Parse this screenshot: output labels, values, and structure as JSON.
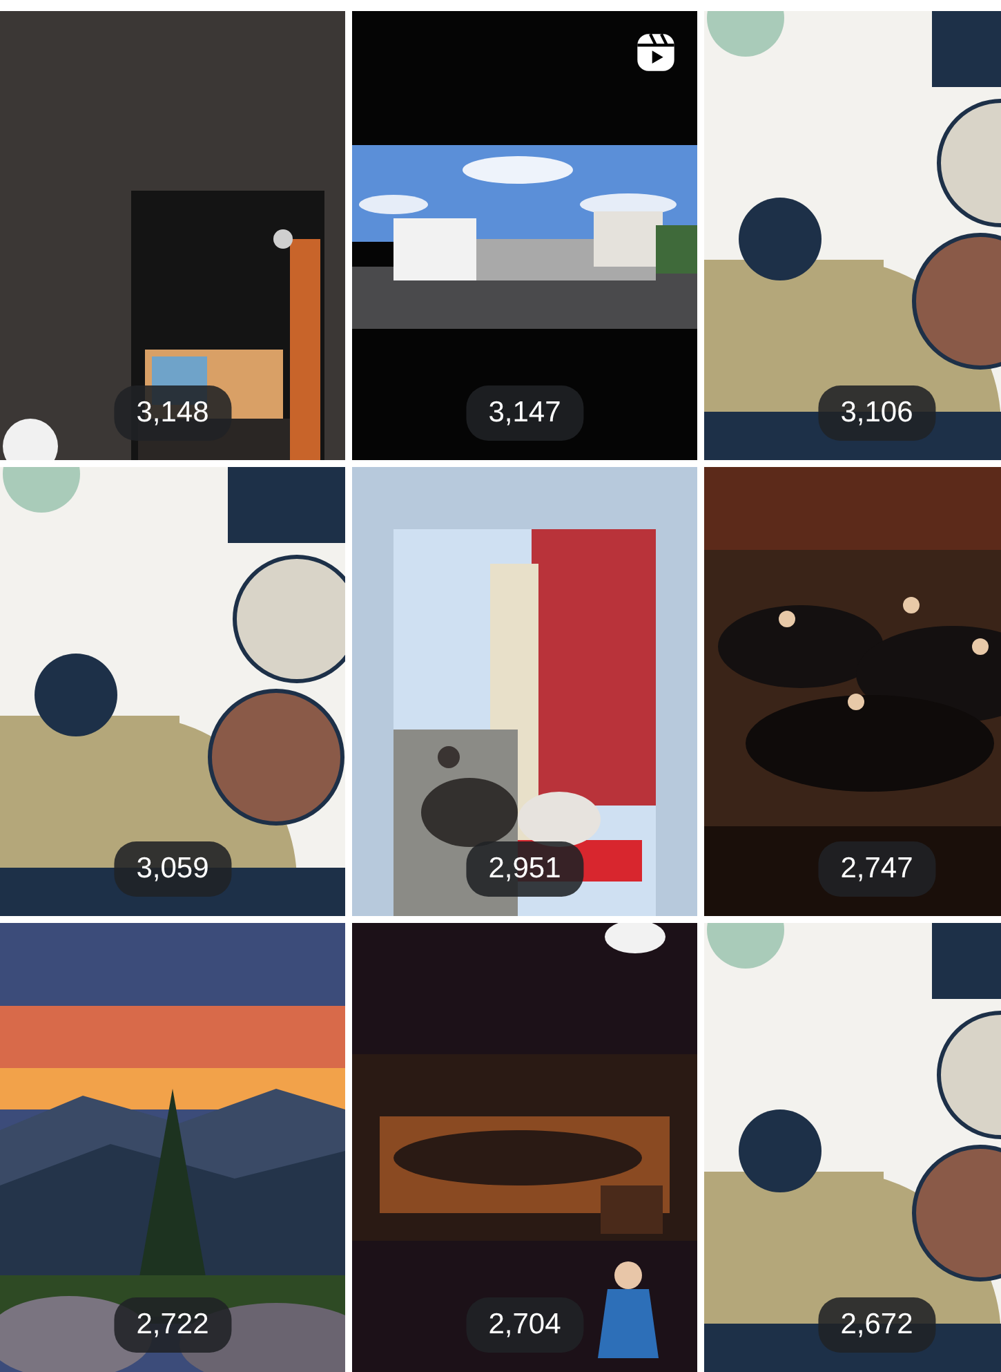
{
  "tiles": [
    {
      "kind": "picture",
      "views": "3,148",
      "reel_icon": false
    },
    {
      "kind": "picture",
      "views": "3,147",
      "reel_icon": true
    },
    {
      "kind": "picture",
      "views": "3,106",
      "reel_icon": false
    },
    {
      "kind": "picture",
      "views": "3,059",
      "reel_icon": false
    },
    {
      "kind": "picture",
      "views": "2,951",
      "reel_icon": false
    },
    {
      "kind": "picture",
      "views": "2,747",
      "reel_icon": false
    },
    {
      "kind": "picture",
      "views": "2,722",
      "reel_icon": false
    },
    {
      "kind": "picture",
      "views": "2,704",
      "reel_icon": false
    },
    {
      "kind": "picture",
      "views": "2,672",
      "reel_icon": false
    }
  ]
}
